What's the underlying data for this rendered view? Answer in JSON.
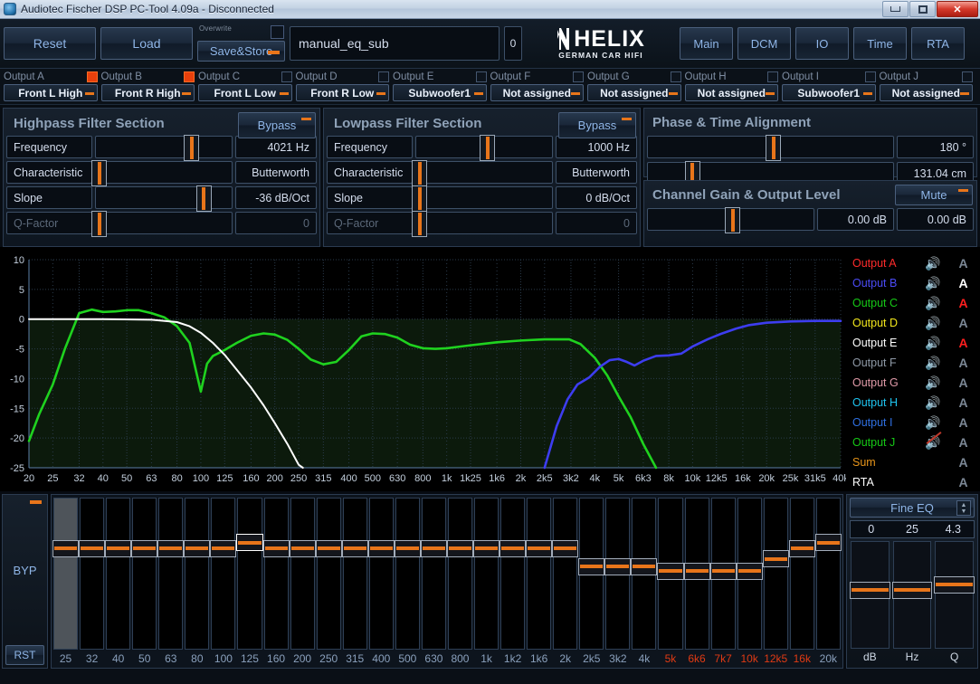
{
  "window": {
    "title": "Audiotec Fischer DSP PC-Tool 4.09a - Disconnected",
    "minimize": "–",
    "maximize": "□",
    "close": "✕"
  },
  "toolbar": {
    "reset": "Reset",
    "load": "Load",
    "overwrite_label": "Overwrite",
    "save_store": "Save&Store",
    "preset_name": "manual_eq_sub",
    "preset_number": "0",
    "logo_main": "HELIX",
    "logo_sub": "GERMAN CAR HIFI",
    "nav": [
      {
        "label": "Main"
      },
      {
        "label": "DCM"
      },
      {
        "label": "IO"
      },
      {
        "label": "Time"
      },
      {
        "label": "RTA"
      }
    ]
  },
  "outputs": [
    {
      "label": "Output A",
      "assignment": "Front L High",
      "checked": true
    },
    {
      "label": "Output B",
      "assignment": "Front R High",
      "checked": true
    },
    {
      "label": "Output C",
      "assignment": "Front L Low",
      "checked": false
    },
    {
      "label": "Output D",
      "assignment": "Front R Low",
      "checked": false
    },
    {
      "label": "Output E",
      "assignment": "Subwoofer1",
      "checked": false
    },
    {
      "label": "Output F",
      "assignment": "Not assigned",
      "checked": false
    },
    {
      "label": "Output G",
      "assignment": "Not assigned",
      "checked": false
    },
    {
      "label": "Output H",
      "assignment": "Not assigned",
      "checked": false
    },
    {
      "label": "Output I",
      "assignment": "Subwoofer1",
      "checked": false
    },
    {
      "label": "Output J",
      "assignment": "Not assigned",
      "checked": false
    }
  ],
  "highpass": {
    "title": "Highpass Filter Section",
    "bypass": "Bypass",
    "rows": [
      {
        "label": "Frequency",
        "value": "4021 Hz",
        "pos": 70
      },
      {
        "label": "Characteristic",
        "value": "Butterworth",
        "pos": 2
      },
      {
        "label": "Slope",
        "value": "-36 dB/Oct",
        "pos": 79
      },
      {
        "label": "Q-Factor",
        "value": "0",
        "pos": 2,
        "dim": true
      }
    ]
  },
  "lowpass": {
    "title": "Lowpass Filter Section",
    "bypass": "Bypass",
    "rows": [
      {
        "label": "Frequency",
        "value": "1000 Hz",
        "pos": 52
      },
      {
        "label": "Characteristic",
        "value": "Butterworth",
        "pos": 2
      },
      {
        "label": "Slope",
        "value": "0 dB/Oct",
        "pos": 2
      },
      {
        "label": "Q-Factor",
        "value": "0",
        "pos": 2,
        "dim": true
      }
    ]
  },
  "phase_time": {
    "title": "Phase & Time Alignment",
    "rows": [
      {
        "value": "180 °",
        "pos": 51
      },
      {
        "value": "131.04 cm",
        "pos": 18
      }
    ]
  },
  "channel_gain": {
    "title": "Channel Gain & Output Level",
    "mute": "Mute",
    "slider_pos": 51,
    "gain": "0.00 dB",
    "level": "0.00 dB"
  },
  "chart_data": {
    "type": "line",
    "title": "",
    "xlabel": "Hz",
    "ylabel": "dB",
    "xlim": [
      20,
      40000
    ],
    "ylim": [
      -25,
      10
    ],
    "grid": true,
    "xticks": [
      "20",
      "25",
      "32",
      "40",
      "50",
      "63",
      "80",
      "100",
      "125",
      "160",
      "200",
      "250",
      "315",
      "400",
      "500",
      "630",
      "800",
      "1k",
      "1k25",
      "1k6",
      "2k",
      "2k5",
      "3k2",
      "4k",
      "5k",
      "6k3",
      "8k",
      "10k",
      "12k5",
      "16k",
      "20k",
      "25k",
      "31k5",
      "40k"
    ],
    "yticks": [
      "10",
      "5",
      "0",
      "-5",
      "-10",
      "-15",
      "-20",
      "-25"
    ],
    "series": [
      {
        "name": "Output C (green lowpass response)",
        "color": "#1fd21f",
        "points": [
          [
            20,
            -20.5
          ],
          [
            22,
            -16
          ],
          [
            25,
            -11
          ],
          [
            28,
            -5
          ],
          [
            32,
            1
          ],
          [
            36,
            1.6
          ],
          [
            40,
            1.2
          ],
          [
            45,
            1.3
          ],
          [
            50,
            1.5
          ],
          [
            56,
            1.5
          ],
          [
            63,
            1.0
          ],
          [
            71,
            0.3
          ],
          [
            80,
            -1.2
          ],
          [
            90,
            -4.0
          ],
          [
            100,
            -12.2
          ],
          [
            106,
            -7.5
          ],
          [
            112,
            -6.2
          ],
          [
            125,
            -5.2
          ],
          [
            140,
            -4.0
          ],
          [
            160,
            -2.8
          ],
          [
            180,
            -2.4
          ],
          [
            200,
            -2.6
          ],
          [
            225,
            -3.5
          ],
          [
            250,
            -5.0
          ],
          [
            280,
            -6.8
          ],
          [
            315,
            -7.6
          ],
          [
            355,
            -7.2
          ],
          [
            400,
            -5.2
          ],
          [
            450,
            -2.9
          ],
          [
            500,
            -2.4
          ],
          [
            560,
            -2.5
          ],
          [
            630,
            -3.1
          ],
          [
            710,
            -4.3
          ],
          [
            800,
            -4.9
          ],
          [
            900,
            -5.0
          ],
          [
            1000,
            -4.9
          ],
          [
            1250,
            -4.4
          ],
          [
            1600,
            -3.9
          ],
          [
            2000,
            -3.6
          ],
          [
            2500,
            -3.4
          ],
          [
            3150,
            -3.4
          ],
          [
            3500,
            -4.2
          ],
          [
            4000,
            -6.5
          ],
          [
            4500,
            -9.5
          ],
          [
            5000,
            -13.0
          ],
          [
            5600,
            -16.5
          ],
          [
            6300,
            -21.0
          ],
          [
            7100,
            -25.0
          ]
        ]
      },
      {
        "name": "Output B (blue highpass response)",
        "color": "#3d3df0",
        "points": [
          [
            2500,
            -25.0
          ],
          [
            2800,
            -18.0
          ],
          [
            3100,
            -13.5
          ],
          [
            3400,
            -11.0
          ],
          [
            3800,
            -9.8
          ],
          [
            4200,
            -8.0
          ],
          [
            4600,
            -6.9
          ],
          [
            5000,
            -6.7
          ],
          [
            5400,
            -7.2
          ],
          [
            5800,
            -7.8
          ],
          [
            6300,
            -7.0
          ],
          [
            7100,
            -6.2
          ],
          [
            8000,
            -6.1
          ],
          [
            9000,
            -5.8
          ],
          [
            10000,
            -4.6
          ],
          [
            11500,
            -3.4
          ],
          [
            13000,
            -2.5
          ],
          [
            15000,
            -1.6
          ],
          [
            17000,
            -1.0
          ],
          [
            20000,
            -0.6
          ],
          [
            25000,
            -0.4
          ],
          [
            31500,
            -0.3
          ],
          [
            40000,
            -0.3
          ]
        ]
      },
      {
        "name": "Filter target (white)",
        "color": "#ffffff",
        "points": [
          [
            20,
            0
          ],
          [
            40,
            0
          ],
          [
            63,
            -0.1
          ],
          [
            80,
            -0.5
          ],
          [
            90,
            -1.2
          ],
          [
            100,
            -2.3
          ],
          [
            112,
            -4.0
          ],
          [
            125,
            -6.0
          ],
          [
            140,
            -8.5
          ],
          [
            160,
            -11.5
          ],
          [
            180,
            -14.5
          ],
          [
            200,
            -17.5
          ],
          [
            225,
            -21.0
          ],
          [
            250,
            -24.5
          ],
          [
            260,
            -25.0
          ]
        ]
      }
    ]
  },
  "legend": [
    {
      "label": "Output A",
      "color": "#ff2b2b",
      "a_color": "#7c8896",
      "muted": false
    },
    {
      "label": "Output B",
      "color": "#4b4bf5",
      "a_color": "#ffffff",
      "muted": false
    },
    {
      "label": "Output C",
      "color": "#16c916",
      "a_color": "#ff1f1f",
      "muted": false
    },
    {
      "label": "Output D",
      "color": "#f2e71c",
      "a_color": "#7c8896",
      "muted": false
    },
    {
      "label": "Output E",
      "color": "#ffffff",
      "a_color": "#ff1f1f",
      "muted": false
    },
    {
      "label": "Output F",
      "color": "#8e99a6",
      "a_color": "#7c8896",
      "muted": false
    },
    {
      "label": "Output G",
      "color": "#e09aa8",
      "a_color": "#7c8896",
      "muted": false
    },
    {
      "label": "Output H",
      "color": "#1fc4ef",
      "a_color": "#7c8896",
      "muted": false
    },
    {
      "label": "Output I",
      "color": "#2f6fe0",
      "a_color": "#7c8896",
      "muted": false
    },
    {
      "label": "Output J",
      "color": "#16c916",
      "a_color": "#7c8896",
      "muted": true
    },
    {
      "label": "Sum",
      "color": "#e8951a",
      "a_color": "#7c8896",
      "muted": false,
      "no_speaker": true
    },
    {
      "label": "RTA",
      "color": "#ffffff",
      "a_color": "#7c8896",
      "muted": false,
      "no_speaker": true
    }
  ],
  "legend_speaker_icon": "🔊",
  "legend_a_letter": "A",
  "eq": {
    "bypass_label": "BYP",
    "reset_label": "RST",
    "bands": [
      {
        "freq": "25",
        "pos": 33,
        "highlight": true,
        "selected": false,
        "red": false
      },
      {
        "freq": "32",
        "pos": 33,
        "highlight": false,
        "selected": false,
        "red": false
      },
      {
        "freq": "40",
        "pos": 33,
        "highlight": false,
        "selected": false,
        "red": false
      },
      {
        "freq": "50",
        "pos": 33,
        "highlight": false,
        "selected": false,
        "red": false
      },
      {
        "freq": "63",
        "pos": 33,
        "highlight": false,
        "selected": false,
        "red": false
      },
      {
        "freq": "80",
        "pos": 33,
        "highlight": false,
        "selected": false,
        "red": false
      },
      {
        "freq": "100",
        "pos": 33,
        "highlight": false,
        "selected": false,
        "red": false
      },
      {
        "freq": "125",
        "pos": 29,
        "highlight": false,
        "selected": true,
        "red": false
      },
      {
        "freq": "160",
        "pos": 33,
        "highlight": false,
        "selected": false,
        "red": false
      },
      {
        "freq": "200",
        "pos": 33,
        "highlight": false,
        "selected": false,
        "red": false
      },
      {
        "freq": "250",
        "pos": 33,
        "highlight": false,
        "selected": false,
        "red": false
      },
      {
        "freq": "315",
        "pos": 33,
        "highlight": false,
        "selected": false,
        "red": false
      },
      {
        "freq": "400",
        "pos": 33,
        "highlight": false,
        "selected": false,
        "red": false
      },
      {
        "freq": "500",
        "pos": 33,
        "highlight": false,
        "selected": false,
        "red": false
      },
      {
        "freq": "630",
        "pos": 33,
        "highlight": false,
        "selected": false,
        "red": false
      },
      {
        "freq": "800",
        "pos": 33,
        "highlight": false,
        "selected": false,
        "red": false
      },
      {
        "freq": "1k",
        "pos": 33,
        "highlight": false,
        "selected": false,
        "red": false
      },
      {
        "freq": "1k2",
        "pos": 33,
        "highlight": false,
        "selected": false,
        "red": false
      },
      {
        "freq": "1k6",
        "pos": 33,
        "highlight": false,
        "selected": false,
        "red": false
      },
      {
        "freq": "2k",
        "pos": 33,
        "highlight": false,
        "selected": false,
        "red": false
      },
      {
        "freq": "2k5",
        "pos": 45,
        "highlight": false,
        "selected": false,
        "red": false
      },
      {
        "freq": "3k2",
        "pos": 45,
        "highlight": false,
        "selected": false,
        "red": false
      },
      {
        "freq": "4k",
        "pos": 45,
        "highlight": false,
        "selected": false,
        "red": false
      },
      {
        "freq": "5k",
        "pos": 48,
        "highlight": false,
        "selected": false,
        "red": true
      },
      {
        "freq": "6k6",
        "pos": 48,
        "highlight": false,
        "selected": false,
        "red": true
      },
      {
        "freq": "7k7",
        "pos": 48,
        "highlight": false,
        "selected": false,
        "red": true
      },
      {
        "freq": "10k",
        "pos": 48,
        "highlight": false,
        "selected": false,
        "red": true
      },
      {
        "freq": "12k5",
        "pos": 40,
        "highlight": false,
        "selected": false,
        "red": true
      },
      {
        "freq": "16k",
        "pos": 33,
        "highlight": false,
        "selected": false,
        "red": true
      },
      {
        "freq": "20k",
        "pos": 29,
        "highlight": false,
        "selected": false,
        "red": false
      }
    ]
  },
  "fine_eq": {
    "title": "Fine EQ",
    "values": [
      "0",
      "25",
      "4.3"
    ],
    "labels": [
      "dB",
      "Hz",
      "Q"
    ],
    "positions": [
      45,
      45,
      40
    ]
  }
}
